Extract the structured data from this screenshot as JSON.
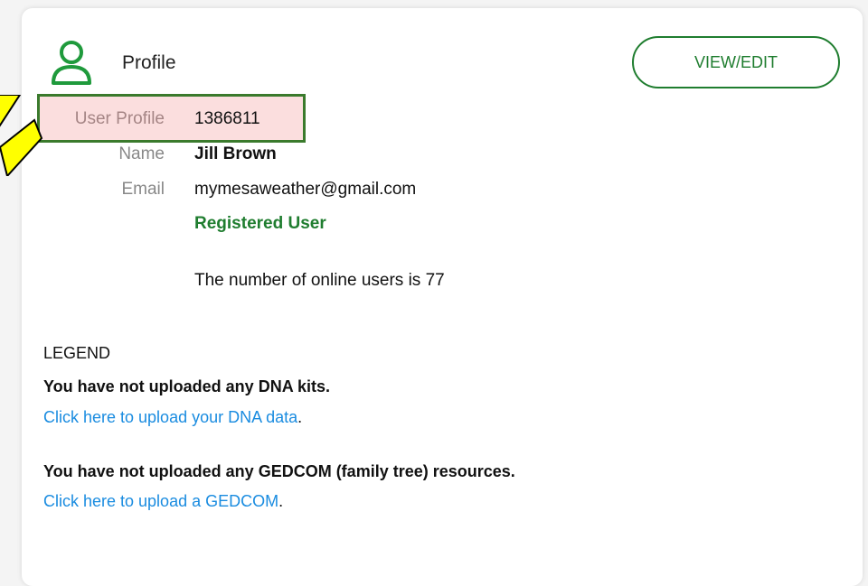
{
  "header": {
    "title": "Profile",
    "view_edit_label": "VIEW/EDIT"
  },
  "details": {
    "user_profile_label": "User Profile",
    "user_profile_value": "1386811",
    "name_label": "Name",
    "name_value": "Jill Brown",
    "email_label": "Email",
    "email_value": "mymesaweather@gmail.com",
    "status": "Registered User",
    "online_users": "The number of online users is 77"
  },
  "legend": {
    "heading": "LEGEND",
    "dna_notice": "You have not uploaded any DNA kits.",
    "dna_link": "Click here to upload your DNA data",
    "gedcom_notice": "You have not uploaded any GEDCOM (family tree) resources.",
    "gedcom_link": "Click here to upload a GEDCOM"
  },
  "colors": {
    "accent_green": "#1f7d2f",
    "link_blue": "#1a8ce0",
    "highlight_fill": "#fbdede",
    "callout_yellow": "#ffff00"
  },
  "icons": [
    "user-profile-icon",
    "callout-arrow"
  ]
}
